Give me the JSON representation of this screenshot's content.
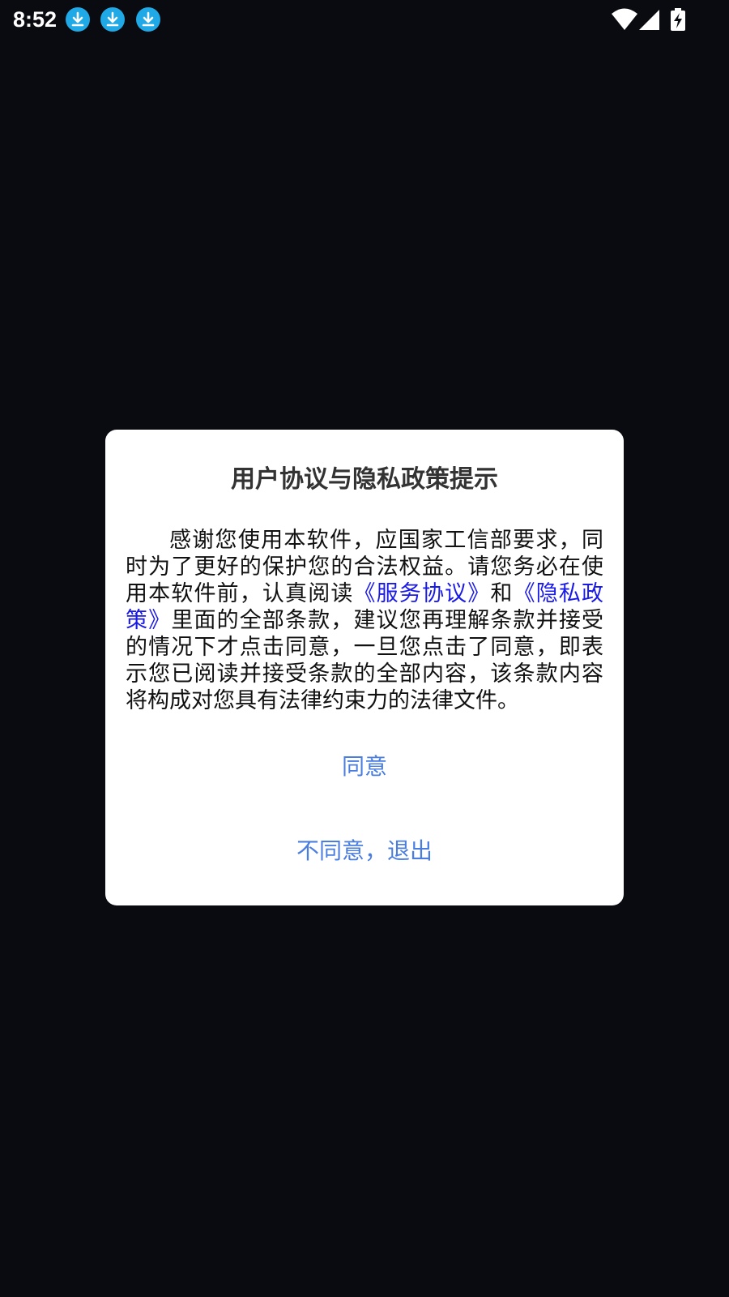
{
  "status_bar": {
    "time": "8:52",
    "notification_icons": [
      "download-icon",
      "download-icon",
      "download-icon"
    ],
    "system_icons": [
      "wifi-icon",
      "signal-icon",
      "battery-charging-icon"
    ]
  },
  "dialog": {
    "title": "用户协议与隐私政策提示",
    "body": {
      "part1": "感谢您使用本软件，应国家工信部要求，同时为了更好的保护您的合法权益。请您务必在使用本软件前，认真阅读",
      "link_service": "《服务协议》",
      "part2": "和",
      "link_privacy": "《隐私政策》",
      "part3": "里面的全部条款，建议您再理解条款并接受的情况下才点击同意，一旦您点击了同意，即表示您已阅读并接受条款的全部内容，该条款内容将构成对您具有法律约束力的法律文件。"
    },
    "agree_label": "同意",
    "disagree_label": "不同意，退出"
  },
  "colors": {
    "background": "#0a0b10",
    "dialog_bg": "#ffffff",
    "link": "#1a1ae6",
    "button_text": "#4a7de0",
    "download_badge": "#1fa9e6"
  }
}
